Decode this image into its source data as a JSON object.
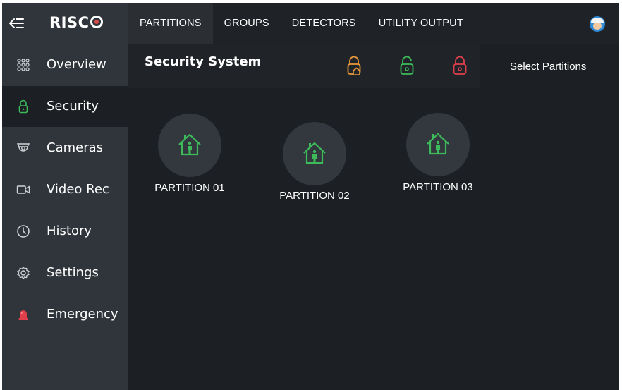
{
  "app": {
    "logo_text": "RISC",
    "back_icon": "back-arrow-icon"
  },
  "tabs": [
    {
      "label": "PARTITIONS",
      "active": true
    },
    {
      "label": "GROUPS",
      "active": false
    },
    {
      "label": "DETECTORS",
      "active": false
    },
    {
      "label": "UTILITY OUTPUT",
      "active": false
    }
  ],
  "sidebar": {
    "items": [
      {
        "label": "Overview",
        "icon": "grid-dots-icon",
        "active": false
      },
      {
        "label": "Security",
        "icon": "lock-icon",
        "active": true
      },
      {
        "label": "Cameras",
        "icon": "camera-icon",
        "active": false
      },
      {
        "label": "Video Rec",
        "icon": "video-icon",
        "active": false
      },
      {
        "label": "History",
        "icon": "history-icon",
        "active": false
      },
      {
        "label": "Settings",
        "icon": "gear-icon",
        "active": false
      },
      {
        "label": "Emergency",
        "icon": "siren-icon",
        "active": false
      }
    ]
  },
  "security": {
    "title": "Security System",
    "select_label": "Select Partitions",
    "lock_buttons": [
      {
        "name": "partial-arm-lock-icon",
        "color": "#e9983a"
      },
      {
        "name": "disarm-lock-icon",
        "color": "#3dbb5b"
      },
      {
        "name": "arm-lock-icon",
        "color": "#e0404c"
      }
    ]
  },
  "partitions": [
    {
      "label": "PARTITION 01",
      "icon": "home-person-icon"
    },
    {
      "label": "PARTITION 02",
      "icon": "home-person-icon"
    },
    {
      "label": "PARTITION 03",
      "icon": "home-person-icon"
    }
  ],
  "colors": {
    "accent_green": "#3dbb5b",
    "sidebar_bg": "#2f353b",
    "main_bg": "#1c1f23"
  }
}
